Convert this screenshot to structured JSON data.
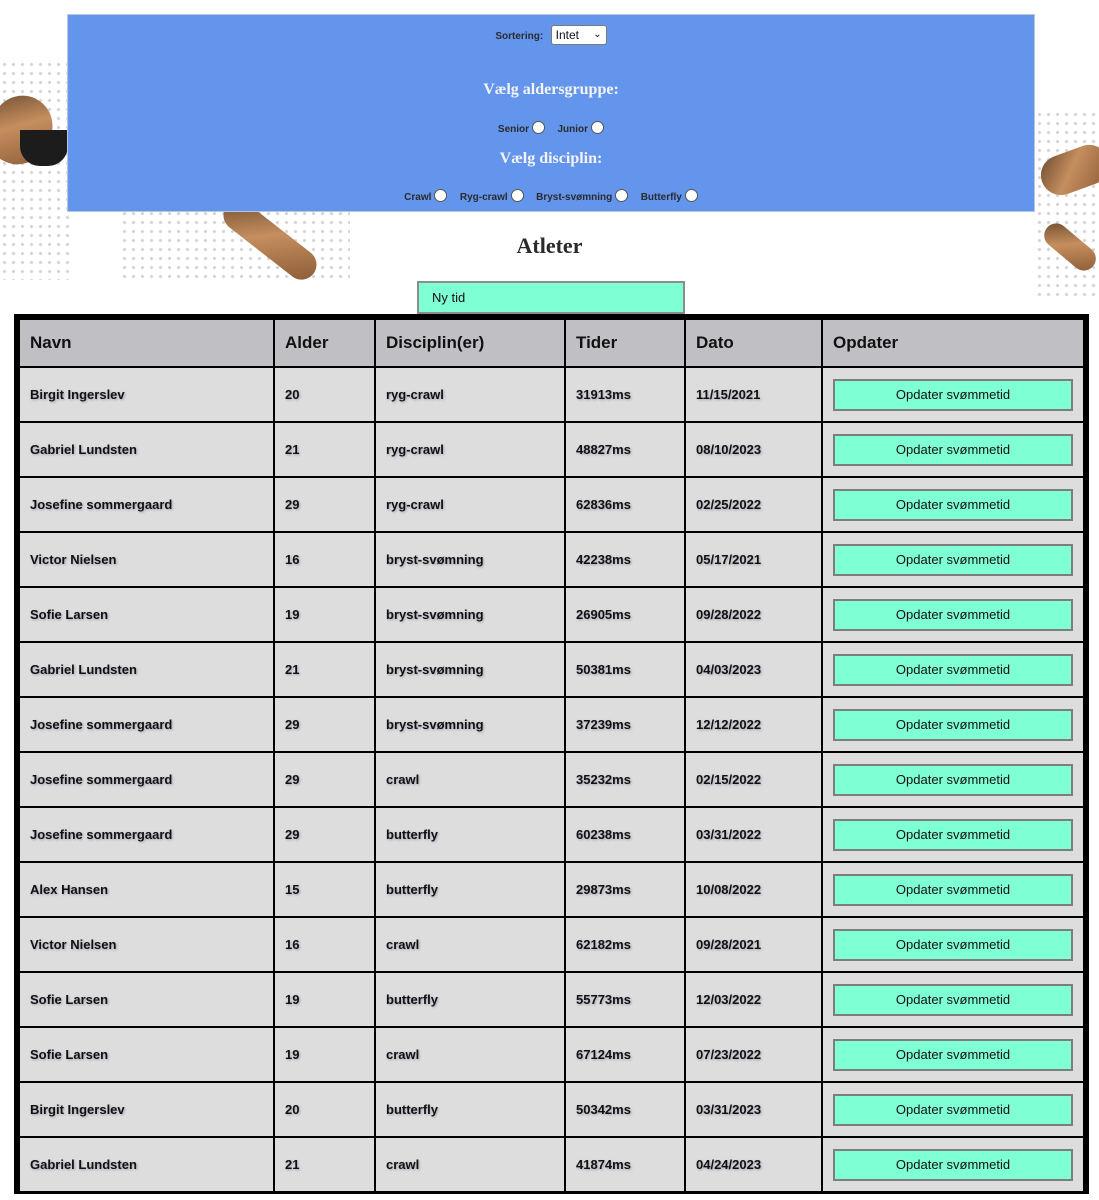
{
  "filters": {
    "sort_label": "Sortering:",
    "sort_value": "Intet",
    "age_heading": "Vælg aldersgruppe:",
    "age_options": [
      "Senior",
      "Junior"
    ],
    "discipline_heading": "Vælg disciplin:",
    "discipline_options": [
      "Crawl",
      "Ryg-crawl",
      "Bryst-svømning",
      "Butterfly"
    ]
  },
  "page_title": "Atleter",
  "new_time_field": "Ny tid",
  "table": {
    "headers": [
      "Navn",
      "Alder",
      "Disciplin(er)",
      "Tider",
      "Dato",
      "Opdater"
    ],
    "update_label": "Opdater svømmetid",
    "rows": [
      [
        "Birgit Ingerslev",
        "20",
        "ryg-crawl",
        "31913ms",
        "11/15/2021"
      ],
      [
        "Gabriel Lundsten",
        "21",
        "ryg-crawl",
        "48827ms",
        "08/10/2023"
      ],
      [
        "Josefine sommergaard",
        "29",
        "ryg-crawl",
        "62836ms",
        "02/25/2022"
      ],
      [
        "Victor Nielsen",
        "16",
        "bryst-svømning",
        "42238ms",
        "05/17/2021"
      ],
      [
        "Sofie Larsen",
        "19",
        "bryst-svømning",
        "26905ms",
        "09/28/2022"
      ],
      [
        "Gabriel Lundsten",
        "21",
        "bryst-svømning",
        "50381ms",
        "04/03/2023"
      ],
      [
        "Josefine sommergaard",
        "29",
        "bryst-svømning",
        "37239ms",
        "12/12/2022"
      ],
      [
        "Josefine sommergaard",
        "29",
        "crawl",
        "35232ms",
        "02/15/2022"
      ],
      [
        "Josefine sommergaard",
        "29",
        "butterfly",
        "60238ms",
        "03/31/2022"
      ],
      [
        "Alex Hansen",
        "15",
        "butterfly",
        "29873ms",
        "10/08/2022"
      ],
      [
        "Victor Nielsen",
        "16",
        "crawl",
        "62182ms",
        "09/28/2021"
      ],
      [
        "Sofie Larsen",
        "19",
        "butterfly",
        "55773ms",
        "12/03/2022"
      ],
      [
        "Sofie Larsen",
        "19",
        "crawl",
        "67124ms",
        "07/23/2022"
      ],
      [
        "Birgit Ingerslev",
        "20",
        "butterfly",
        "50342ms",
        "03/31/2023"
      ],
      [
        "Gabriel Lundsten",
        "21",
        "crawl",
        "41874ms",
        "04/24/2023"
      ]
    ]
  },
  "colors": {
    "panel": "#6495ed",
    "accent": "#7fffd4",
    "header_bg": "#c0bfc4",
    "cell_bg": "#dddddd"
  }
}
